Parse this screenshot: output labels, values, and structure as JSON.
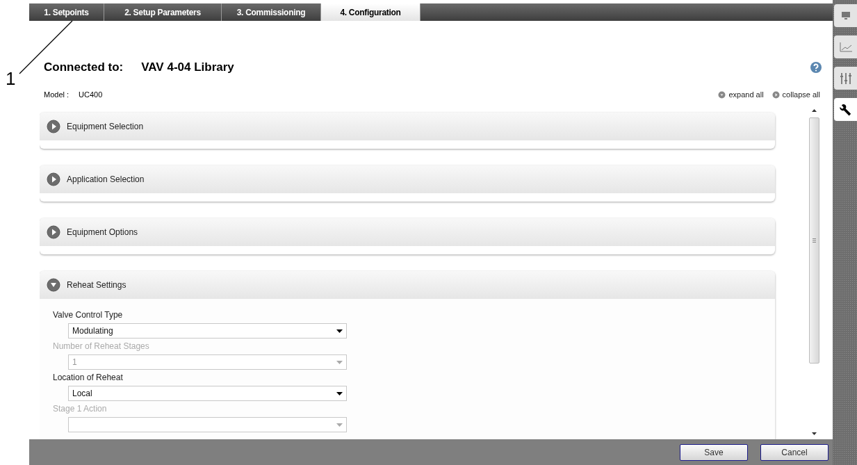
{
  "callout": {
    "label": "1"
  },
  "tabs": [
    {
      "label": "1. Setpoints",
      "selected": false
    },
    {
      "label": "2. Setup Parameters",
      "selected": false
    },
    {
      "label": "3. Commissioning",
      "selected": false
    },
    {
      "label": "4. Configuration",
      "selected": true
    }
  ],
  "side_tabs": [
    {
      "kind": "monitor",
      "selected": false
    },
    {
      "kind": "chart",
      "selected": false
    },
    {
      "kind": "sliders",
      "selected": false
    },
    {
      "kind": "wrench",
      "selected": true
    }
  ],
  "header": {
    "prefix": "Connected to:",
    "device": "VAV 4-04 Library",
    "model_label": "Model :",
    "model": "UC400"
  },
  "links": [
    {
      "kind": "expand",
      "label": "expand all"
    },
    {
      "kind": "collapse",
      "label": "collapse all"
    }
  ],
  "sections": [
    {
      "title": "Equipment Selection",
      "expanded": false
    },
    {
      "title": "Application Selection",
      "expanded": false
    },
    {
      "title": "Equipment Options",
      "expanded": false
    },
    {
      "title": "Reheat Settings",
      "expanded": true,
      "fields": [
        {
          "label": "Valve Control Type",
          "value": "Modulating",
          "disabled": false
        },
        {
          "label": "Number of Reheat Stages",
          "value": "1",
          "disabled": true
        },
        {
          "label": "Location of Reheat",
          "value": "Local",
          "disabled": false
        },
        {
          "label": "Stage 1 Action",
          "disabled": true
        }
      ]
    }
  ],
  "buttons": [
    "Save",
    "Cancel"
  ]
}
